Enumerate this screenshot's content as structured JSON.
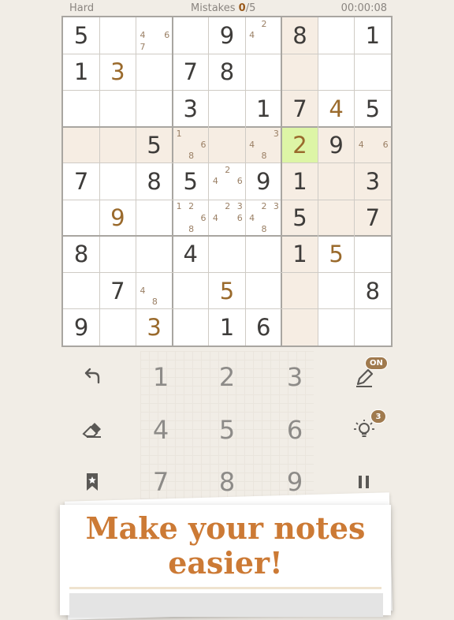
{
  "header": {
    "difficulty": "Hard",
    "mistakes_label": "Mistakes",
    "mistakes_count": "0",
    "mistakes_max": "/5",
    "timer": "00:00:08"
  },
  "board": {
    "selected_cell": [
      3,
      6
    ],
    "highlight_color": "#f6ede3",
    "selected_color": "#ddf5a6",
    "cells": [
      [
        "5",
        "",
        "",
        "",
        "9",
        "",
        "8",
        "",
        "1"
      ],
      [
        "1",
        "3",
        "",
        "7",
        "8",
        "",
        "",
        "",
        ""
      ],
      [
        "",
        "",
        "",
        "3",
        "",
        "1",
        "7",
        "4",
        "5"
      ],
      [
        "",
        "",
        "5",
        "",
        "",
        "",
        "2",
        "9",
        ""
      ],
      [
        "7",
        "",
        "8",
        "5",
        "",
        "9",
        "1",
        "",
        "3"
      ],
      [
        "",
        "9",
        "",
        "",
        "",
        "",
        "5",
        "",
        "7"
      ],
      [
        "8",
        "",
        "",
        "4",
        "",
        "",
        "1",
        "5",
        ""
      ],
      [
        "",
        "7",
        "",
        "",
        "5",
        "",
        "",
        "",
        "8"
      ],
      [
        "9",
        "",
        "3",
        "",
        "1",
        "6",
        "",
        "",
        ""
      ]
    ],
    "user_cells": [
      [
        1,
        1
      ],
      [
        2,
        7
      ],
      [
        3,
        6
      ],
      [
        5,
        1
      ],
      [
        6,
        7
      ],
      [
        7,
        4
      ],
      [
        8,
        2
      ]
    ],
    "notes": [
      {
        "r": 0,
        "c": 2,
        "n": [
          4,
          6,
          7
        ]
      },
      {
        "r": 0,
        "c": 5,
        "n": [
          2,
          4
        ]
      },
      {
        "r": 3,
        "c": 3,
        "n": [
          1,
          6,
          8
        ]
      },
      {
        "r": 3,
        "c": 5,
        "n": [
          3,
          4,
          8
        ]
      },
      {
        "r": 3,
        "c": 8,
        "n": [
          4,
          6
        ]
      },
      {
        "r": 4,
        "c": 4,
        "n": [
          2,
          4,
          6
        ]
      },
      {
        "r": 5,
        "c": 3,
        "n": [
          1,
          2,
          6,
          8
        ]
      },
      {
        "r": 5,
        "c": 4,
        "n": [
          2,
          3,
          4,
          6
        ]
      },
      {
        "r": 5,
        "c": 5,
        "n": [
          2,
          3,
          4,
          8
        ]
      },
      {
        "r": 7,
        "c": 2,
        "n": [
          4,
          8
        ]
      }
    ]
  },
  "keypad": {
    "numbers": [
      "1",
      "2",
      "3",
      "4",
      "5",
      "6",
      "7",
      "8",
      "9"
    ]
  },
  "tools": {
    "undo_icon": "undo-arrow",
    "erase_icon": "eraser",
    "bookmark_icon": "bookmark-star",
    "pencil_icon": "pencil",
    "pencil_badge": "ON",
    "hint_icon": "lightbulb",
    "hint_badge": "3",
    "pause_icon": "pause"
  },
  "banner": {
    "line1": "Make your notes",
    "line2": "easier!"
  },
  "colors": {
    "accent": "#cc7a35",
    "user_digit": "#9a6a2c",
    "badge": "#a07a4e"
  }
}
